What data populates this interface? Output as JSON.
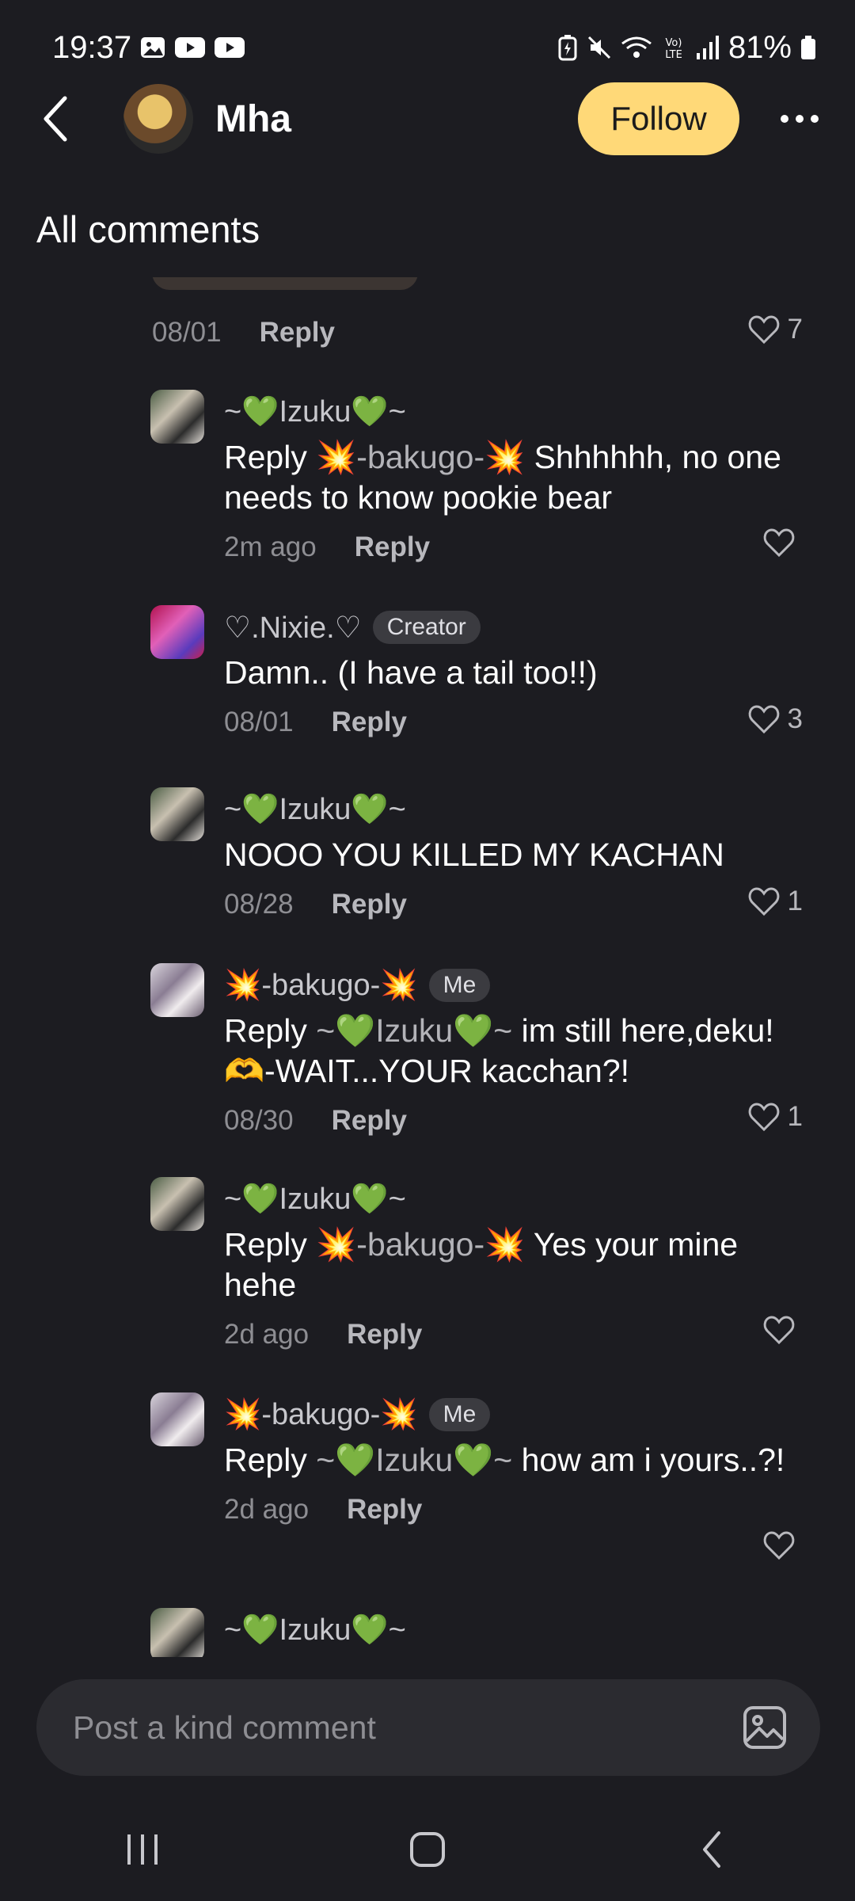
{
  "status": {
    "time": "19:37",
    "battery": "81%"
  },
  "header": {
    "title": "Mha",
    "follow_label": "Follow"
  },
  "section_title": "All comments",
  "prev_comment": {
    "date": "08/01",
    "reply_label": "Reply",
    "likes": "7"
  },
  "comments": [
    {
      "user": "~💚Izuku💚~",
      "badge": "",
      "prefix": "Reply",
      "mention": "💥-bakugo-💥",
      "text": "Shhhhhh, no one needs to know pookie bear",
      "time": "2m ago",
      "reply_label": "Reply",
      "likes": ""
    },
    {
      "user": "♡.Nixie.♡",
      "badge": "Creator",
      "prefix": "",
      "mention": "",
      "text": "Damn.. (I have a tail too!!)",
      "time": "08/01",
      "reply_label": "Reply",
      "likes": "3"
    },
    {
      "user": "~💚Izuku💚~",
      "badge": "",
      "prefix": "",
      "mention": "",
      "text": "NOOO YOU KILLED MY KACHAN",
      "time": "08/28",
      "reply_label": "Reply",
      "likes": "1"
    },
    {
      "user": "💥-bakugo-💥",
      "badge": "Me",
      "prefix": "Reply",
      "mention": "~💚Izuku💚~",
      "text": "im still here,deku! 🫶-WAIT...YOUR kacchan?!",
      "time": "08/30",
      "reply_label": "Reply",
      "likes": "1"
    },
    {
      "user": "~💚Izuku💚~",
      "badge": "",
      "prefix": "Reply",
      "mention": "💥-bakugo-💥",
      "text": "Yes your mine hehe",
      "time": "2d ago",
      "reply_label": "Reply",
      "likes": ""
    },
    {
      "user": "💥-bakugo-💥",
      "badge": "Me",
      "prefix": "Reply",
      "mention": "~💚Izuku💚~",
      "text": "how am i yours..?!",
      "time": "2d ago",
      "reply_label": "Reply",
      "likes": ""
    },
    {
      "user": "~💚Izuku💚~",
      "badge": "",
      "prefix": "",
      "mention": "",
      "text": "",
      "time": "",
      "reply_label": "",
      "likes": ""
    }
  ],
  "composer": {
    "placeholder": "Post a kind comment"
  }
}
